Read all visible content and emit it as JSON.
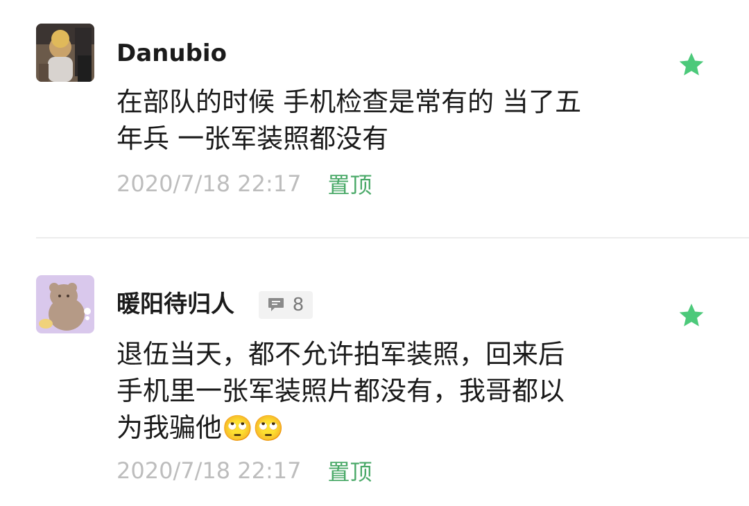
{
  "accent_color": "#4aa968",
  "comments": [
    {
      "username": "Danubio",
      "body_lines": [
        "在部队的时候 手机检查是常有的 当了五",
        "年兵 一张军装照都没有"
      ],
      "timestamp": "2020/7/18 22:17",
      "pin_label": "置顶",
      "star_icon": "star-icon"
    },
    {
      "username": "暖阳待归人",
      "reply_icon": "comment-bubble-icon",
      "reply_count": "8",
      "body_lines": [
        "退伍当天，都不允许拍军装照，回来后",
        "手机里一张军装照片都没有，我哥都以",
        "为我骗他"
      ],
      "emojis": [
        "🙄",
        "🙄"
      ],
      "timestamp": "2020/7/18 22:17",
      "pin_label": "置顶",
      "star_icon": "star-icon"
    }
  ]
}
